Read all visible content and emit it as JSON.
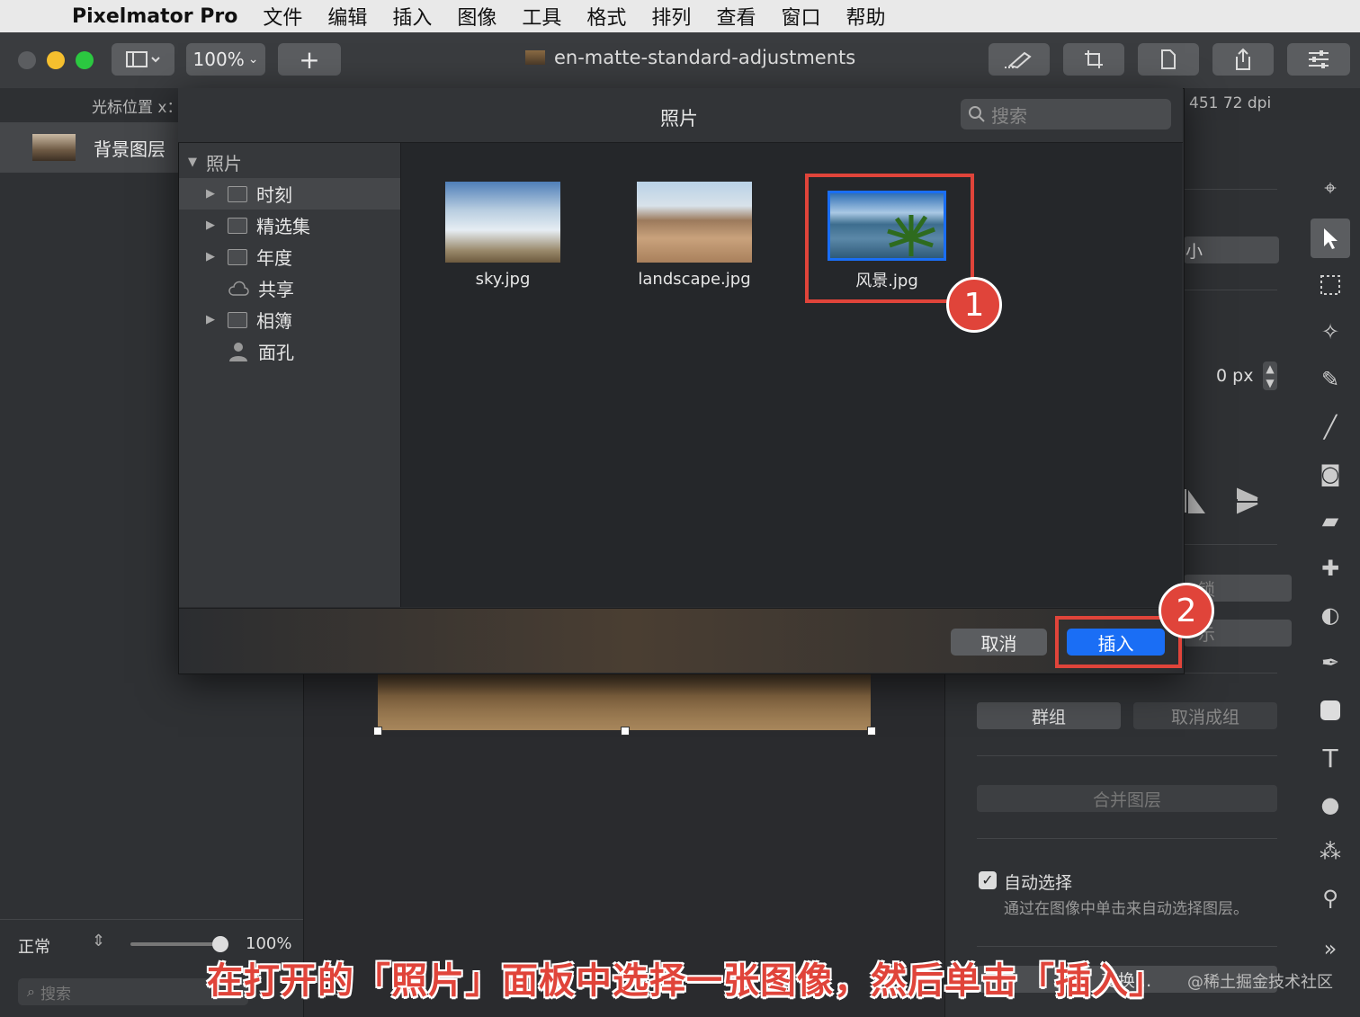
{
  "menubar": {
    "app_name": "Pixelmator Pro",
    "items": [
      "文件",
      "编辑",
      "插入",
      "图像",
      "工具",
      "格式",
      "排列",
      "查看",
      "窗口",
      "帮助"
    ]
  },
  "toolbar": {
    "zoom": "100%",
    "add": "+",
    "doc_title": "en-matte-standard-adjustments"
  },
  "infobar": {
    "cursor_label": "光标位置 x：",
    "dpi": "451 72 dpi"
  },
  "layers": {
    "layer_name": "背景图层",
    "blend_mode": "正常",
    "opacity": "100%",
    "opacity_value": 1.0,
    "search_placeholder": "搜索"
  },
  "dialog": {
    "title": "照片",
    "search_placeholder": "搜索",
    "sidebar": {
      "root": "照片",
      "items": [
        {
          "label": "时刻",
          "icon": "album-icon",
          "expandable": true
        },
        {
          "label": "精选集",
          "icon": "album-icon",
          "expandable": true
        },
        {
          "label": "年度",
          "icon": "album-icon",
          "expandable": true
        },
        {
          "label": "共享",
          "icon": "cloud-icon",
          "expandable": false
        },
        {
          "label": "相簿",
          "icon": "album-icon",
          "expandable": true
        },
        {
          "label": "面孔",
          "icon": "person-icon",
          "expandable": false
        }
      ]
    },
    "photos": [
      {
        "name": "sky.jpg"
      },
      {
        "name": "landscape.jpg"
      },
      {
        "name": "风景.jpg",
        "selected": true
      }
    ],
    "cancel_label": "取消",
    "insert_label": "插入"
  },
  "right_panel": {
    "size_label": "小",
    "px_value": "0 px",
    "lock_label": "锁",
    "show_label": "示",
    "group_label": "群组",
    "ungroup_label": "取消成组",
    "merge_label": "合并图层",
    "auto_select_label": "自动选择",
    "auto_select_desc": "通过在图像中单击来自动选择图层。",
    "transform_label": "变换..."
  },
  "annotations": {
    "step1": "1",
    "step2": "2",
    "caption": "在打开的「照片」面板中选择一张图像，然后单击「插入」",
    "watermark": "@稀土掘金技术社区"
  },
  "colors": {
    "accent": "#1a6ef5",
    "annotation_red": "#e0443a"
  }
}
